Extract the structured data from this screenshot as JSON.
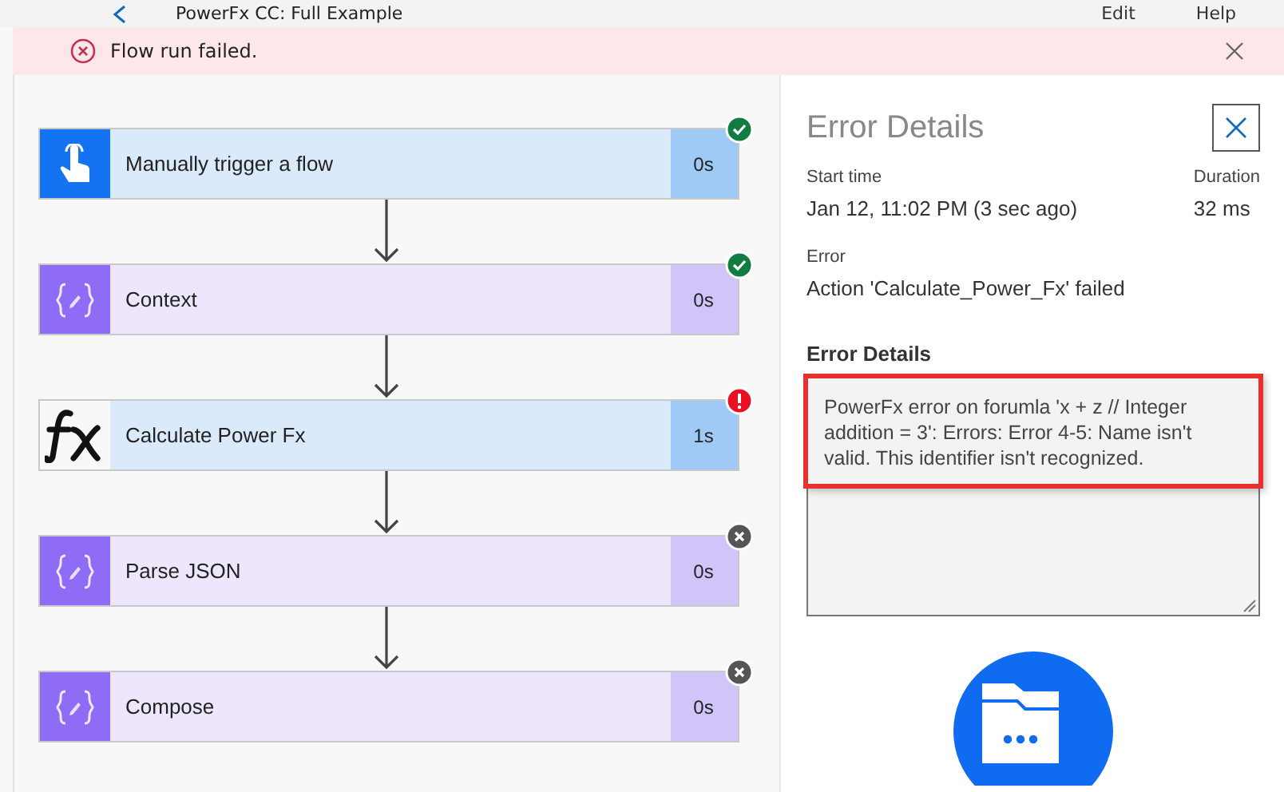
{
  "header": {
    "title": "PowerFx CC: Full Example",
    "actions": [
      "Edit",
      "Help"
    ]
  },
  "banner": {
    "message": "Flow run failed."
  },
  "steps": [
    {
      "kind": "trigger",
      "label": "Manually trigger a flow",
      "duration": "0s",
      "badge": {
        "kind": "succeeded"
      }
    },
    {
      "kind": "compose",
      "label": "Context",
      "duration": "0s",
      "badge": {
        "kind": "succeeded"
      }
    },
    {
      "kind": "fx",
      "label": "Calculate Power Fx",
      "duration": "1s",
      "badge": {
        "kind": "failed"
      }
    },
    {
      "kind": "compose",
      "label": "Parse JSON",
      "duration": "0s",
      "badge": {
        "kind": "skipped"
      }
    },
    {
      "kind": "compose",
      "label": "Compose",
      "duration": "0s",
      "badge": {
        "kind": "skipped"
      }
    }
  ],
  "panel": {
    "title": "Error Details",
    "start_label": "Start time",
    "start_value": "Jan 12, 11:02 PM (3 sec ago)",
    "duration_label": "Duration",
    "duration_value": "32 ms",
    "error_label": "Error",
    "error_value": "Action 'Calculate_Power_Fx' failed",
    "details_label": "Error Details",
    "details_value": "PowerFx error on forumla 'x + z  // Integer addition = 3': Errors: Error 4-5: Name isn't valid. This identifier isn't recognized.",
    "highlighted": true
  }
}
